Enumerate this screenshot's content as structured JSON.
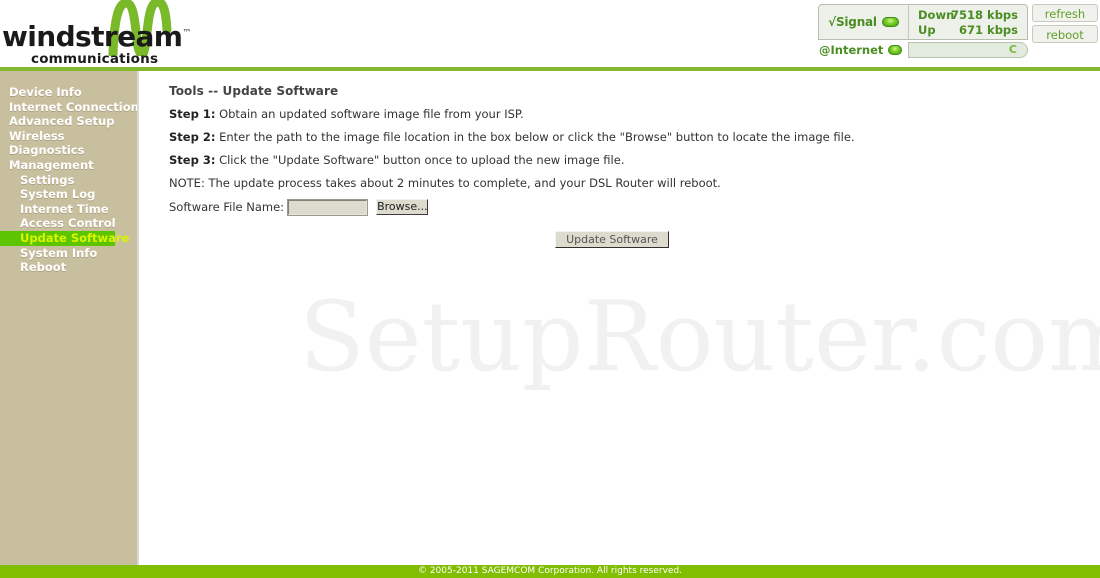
{
  "brand": {
    "name": "windstream",
    "tm": "™",
    "tagline": "communications",
    "logo_icon": "windstream-wave-mark",
    "accent_green": "#84b830",
    "footer_green": "#81bd00",
    "sidebar_tan": "#c8bf9f",
    "active_green": "#5cc400",
    "active_text": "#d9f500"
  },
  "status": {
    "signal_label": "√Signal",
    "signal_led": "led-green-on",
    "internet_label": "@Internet",
    "internet_led": "led-green-on",
    "progress_text": "C",
    "rates": [
      {
        "name": "Down",
        "value": "7518 kbps"
      },
      {
        "name": "Up",
        "value": "671 kbps"
      }
    ],
    "buttons": [
      {
        "label": "refresh",
        "name": "refresh-button"
      },
      {
        "label": "reboot",
        "name": "reboot-button"
      }
    ]
  },
  "sidebar": {
    "items": [
      {
        "label": "Device Info",
        "level": 0,
        "active": false
      },
      {
        "label": "Internet Connection",
        "level": 0,
        "active": false
      },
      {
        "label": "Advanced Setup",
        "level": 0,
        "active": false
      },
      {
        "label": "Wireless",
        "level": 0,
        "active": false
      },
      {
        "label": "Diagnostics",
        "level": 0,
        "active": false
      },
      {
        "label": "Management",
        "level": 0,
        "active": false
      },
      {
        "label": "Settings",
        "level": 1,
        "active": false
      },
      {
        "label": "System Log",
        "level": 1,
        "active": false
      },
      {
        "label": "Internet Time",
        "level": 1,
        "active": false
      },
      {
        "label": "Access Control",
        "level": 1,
        "active": false
      },
      {
        "label": "Update Software",
        "level": 1,
        "active": true
      },
      {
        "label": "System Info",
        "level": 1,
        "active": false
      },
      {
        "label": "Reboot",
        "level": 1,
        "active": false
      }
    ]
  },
  "main": {
    "title": "Tools -- Update Software",
    "steps": [
      {
        "prefix": "Step 1:",
        "text": " Obtain an updated software image file from your ISP."
      },
      {
        "prefix": "Step 2:",
        "text": " Enter the path to the image file location in the box below or click the \"Browse\" button to locate the image file."
      },
      {
        "prefix": "Step 3:",
        "text": " Click the \"Update Software\" button once to upload the new image file."
      }
    ],
    "note": "NOTE: The update process takes about 2 minutes to complete, and your DSL Router will reboot.",
    "file_label": "Software File Name:",
    "file_value": "",
    "file_placeholder": "",
    "browse_label": "Browse...",
    "update_label": "Update Software"
  },
  "watermark": "SetupRouter.com",
  "footer": {
    "text": "© 2005-2011 SAGEMCOM Corporation. All rights reserved."
  }
}
